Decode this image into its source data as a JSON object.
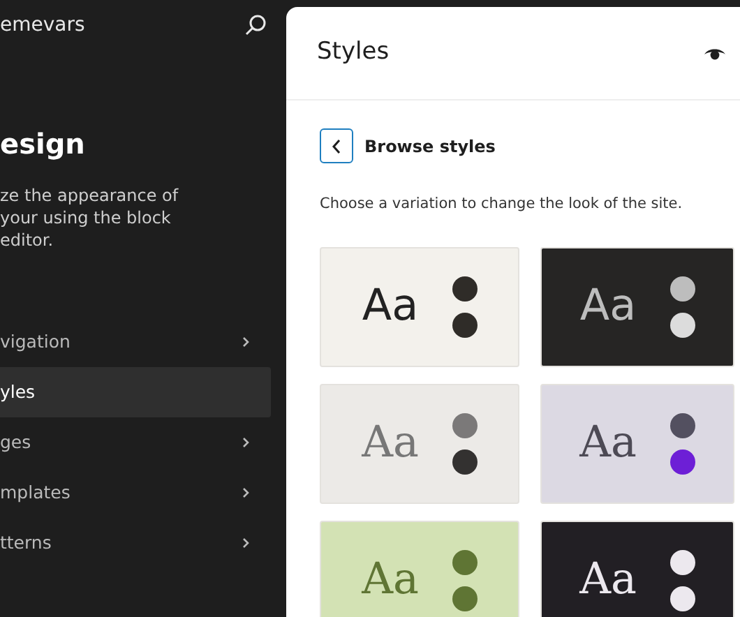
{
  "sidebar": {
    "site_title": "emevars",
    "heading": "esign",
    "description": "ze the appearance of your using the block editor.",
    "items": [
      {
        "label": "vigation",
        "selected": false
      },
      {
        "label": "yles",
        "selected": true
      },
      {
        "label": "ges",
        "selected": false
      },
      {
        "label": "mplates",
        "selected": false
      },
      {
        "label": "tterns",
        "selected": false
      }
    ]
  },
  "panel": {
    "title": "Styles",
    "back_label": "Browse styles",
    "description": "Choose a variation to change the look of the site.",
    "variations": [
      {
        "sample": "Aa",
        "kind": "linen",
        "dots": [
          {
            "color": "#2f2c28"
          },
          {
            "color": "#2f2c28"
          }
        ]
      },
      {
        "sample": "Aa",
        "kind": "charcoal",
        "dots": [
          {
            "color": "#bdbdbd"
          },
          {
            "color": "#dcdcdc"
          }
        ]
      },
      {
        "sample": "Aa",
        "kind": "stone",
        "dots": [
          {
            "color": "#7b7979"
          },
          {
            "color": "#333130"
          }
        ]
      },
      {
        "sample": "Aa",
        "kind": "lavender",
        "dots": [
          {
            "color": "#535060"
          },
          {
            "color": "#6d1fd6"
          }
        ]
      },
      {
        "sample": "Aa",
        "kind": "sage",
        "dots": [
          {
            "color": "#5f7534"
          },
          {
            "color": "#5f7534"
          }
        ]
      },
      {
        "sample": "Aa",
        "kind": "midnight",
        "dots": [
          {
            "color": "#ece8ee"
          },
          {
            "color": "#ece8ee"
          }
        ]
      }
    ]
  }
}
